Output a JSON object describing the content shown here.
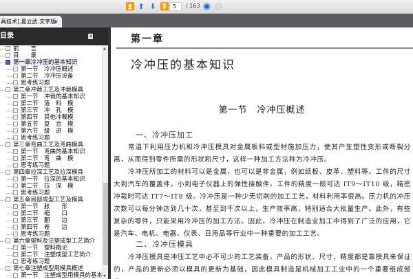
{
  "toolbar": {
    "page": "5",
    "total": "/ 163",
    "buttons": [
      "first-page",
      "prev-page",
      "next-page",
      "last-page"
    ]
  },
  "tab": {
    "title": "具技术].夏立武.文字版",
    "close": "×"
  },
  "sidebar": {
    "title": "目录",
    "collapse": "◂",
    "items": [
      {
        "label": "前　　言",
        "level": 0
      },
      {
        "label": "目　　录",
        "level": 0
      },
      {
        "label": "第一章冷冲压的基本知识",
        "level": 0,
        "selected": true
      },
      {
        "label": "第一节　冷冲压概述",
        "level": 1
      },
      {
        "label": "第二节　冷冲压设备",
        "level": 1
      },
      {
        "label": "思考练习题",
        "level": 1
      },
      {
        "label": "第二章冲裁工艺及冲裁模具",
        "level": 0
      },
      {
        "label": "第一节　冲裁的基本知识",
        "level": 1
      },
      {
        "label": "第二节　落　料　模",
        "level": 1
      },
      {
        "label": "第三节　冲　孔　模",
        "level": 1
      },
      {
        "label": "第四节　其他冲裁模",
        "level": 1
      },
      {
        "label": "第五节　复　合　模",
        "level": 1
      },
      {
        "label": "第六节　级　进　模",
        "level": 1
      },
      {
        "label": "思考练习题",
        "level": 1
      },
      {
        "label": "第三章弯曲工艺及弯曲模具",
        "level": 0
      },
      {
        "label": "第一节　弯曲的基本知识",
        "level": 1
      },
      {
        "label": "第二节　弯　曲　模",
        "level": 1
      },
      {
        "label": "思考练习题",
        "level": 1
      },
      {
        "label": "第四章拉深工艺及拉深模具",
        "level": 0
      },
      {
        "label": "第一节　拉深的基本知识",
        "level": 1
      },
      {
        "label": "第二节　拉　深　模",
        "level": 1
      },
      {
        "label": "思考练习题",
        "level": 1
      },
      {
        "label": "第五章局部成型工艺及模具",
        "level": 0
      },
      {
        "label": "第一节　胀　　形",
        "level": 1
      },
      {
        "label": "第二节　缩　　口",
        "level": 1
      },
      {
        "label": "第三节　翻　　边",
        "level": 1
      },
      {
        "label": "第四节　卷　　边",
        "level": 1
      },
      {
        "label": "思考练习题",
        "level": 1
      },
      {
        "label": "第六章塑料及注塑成型工艺简介",
        "level": 0
      },
      {
        "label": "第一节　塑料概论",
        "level": 1
      },
      {
        "label": "第二节　注塑成型工艺简介",
        "level": 1
      },
      {
        "label": "思考练习题",
        "level": 1
      },
      {
        "label": "第七章注塑成型用模具概述",
        "level": 0
      },
      {
        "label": "第一节　注塑成型用模具的基本",
        "level": 1
      }
    ]
  },
  "document": {
    "chapter": "第一章",
    "title": "冷冲压的基本知识",
    "section": "第一节　冷冲压概述",
    "h1": "一、冷冲压加工",
    "p1": "常温下利用压力机和冷冲压模具对金属板料或型材施加压力，使其产生塑性变形或断裂分离，从而得到零件所需的形状和尺寸，这样一种加工方法称为冷冲压。",
    "p2": "冷冲压所加工的材料可以是金属，也可以是非金属，例如纸板、皮革、塑料等。工件的尺寸大到汽车的覆盖件，小到电子仪器上的弹性接触件。工件的精度一般可达 IT9～IT10 级，精密冲裁时可达 IT7～IT8 级。冷冲压是一种少无切削的加工工艺，材料利用率很高。压力机的冲压次数可以每分钟达到几十次，甚至到千次以上，生产效率高，特别适合大批量生产。此外，有些复杂的零件，只能采用冷冲压的加工方法。因此，冷冲压在制造业加工中得到了广泛的应用，它是汽车、电机、电器、仪表、日用品等行业中一种重要的加工工艺。",
    "h2": "二、冷冲压模具",
    "p3": "冷冲压模具是冲压工艺中必不可少的工艺装备，产品的形状、尺寸、精度都是靠模具来保证的，产品的更新必须以模具的更新为基础，因此模具制造是机械加工工业中的一个重要组成部分。"
  }
}
